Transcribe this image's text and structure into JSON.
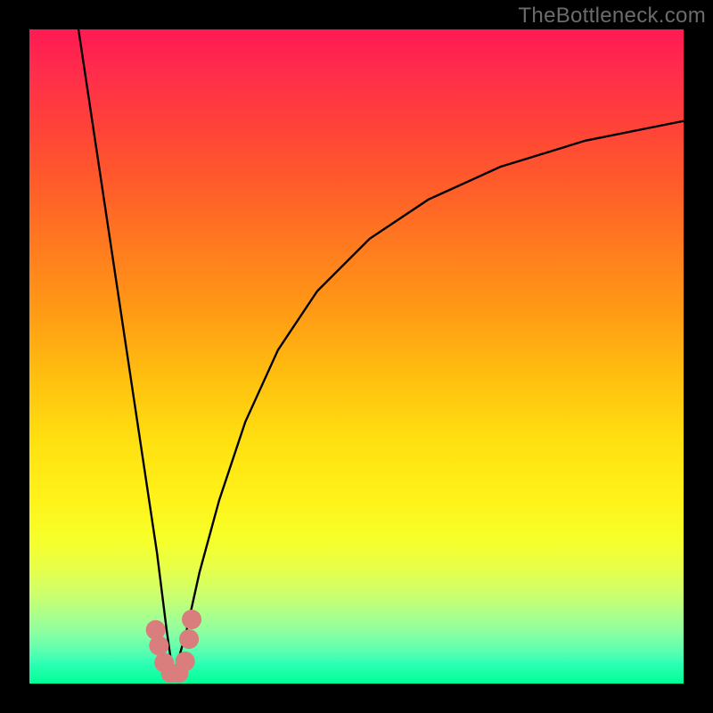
{
  "watermark": "TheBottleneck.com",
  "colors": {
    "frame": "#000000",
    "curve": "#000000",
    "marker_fill": "#d97d7d",
    "marker_stroke": "#c65c5c",
    "gradient_top": "#ff1a53",
    "gradient_bottom": "#00ff95"
  },
  "chart_data": {
    "type": "line",
    "title": "",
    "xlabel": "",
    "ylabel": "",
    "xlim": [
      0,
      100
    ],
    "ylim": [
      0,
      100
    ],
    "note": "Values are read in plot-percentage coordinates; x left→right 0–100, y bottom→top 0–100. Two branches form a V with minimum near x≈22, y≈0.",
    "series": [
      {
        "name": "left-branch",
        "x": [
          7.5,
          9,
          10.5,
          12,
          13.5,
          15,
          16.5,
          18,
          19.5,
          21,
          22
        ],
        "y": [
          100,
          90,
          80,
          70,
          60,
          50,
          40,
          30,
          20,
          8,
          1
        ]
      },
      {
        "name": "right-branch",
        "x": [
          22,
          24,
          26,
          29,
          33,
          38,
          44,
          52,
          61,
          72,
          85,
          100
        ],
        "y": [
          1,
          8,
          17,
          28,
          40,
          51,
          60,
          68,
          74,
          79,
          83,
          86
        ]
      }
    ],
    "markers": {
      "name": "highlight-cluster",
      "points": [
        {
          "x": 19.3,
          "y": 8.2
        },
        {
          "x": 19.8,
          "y": 5.8
        },
        {
          "x": 20.6,
          "y": 3.2
        },
        {
          "x": 21.6,
          "y": 1.6
        },
        {
          "x": 22.8,
          "y": 1.6
        },
        {
          "x": 23.8,
          "y": 3.4
        },
        {
          "x": 24.4,
          "y": 6.8
        },
        {
          "x": 24.8,
          "y": 9.8
        }
      ],
      "radius_pct": 1.5
    }
  }
}
